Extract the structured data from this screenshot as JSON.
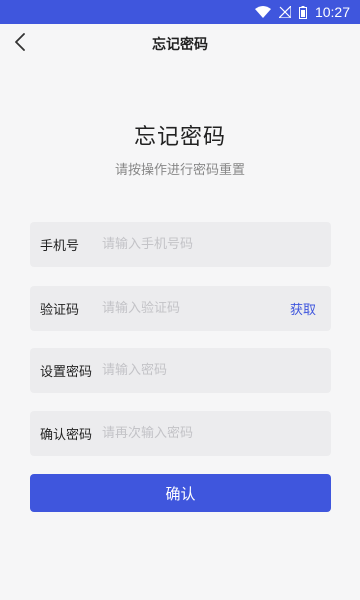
{
  "status_bar": {
    "time": "10:27",
    "icons": [
      "wifi-icon",
      "signal-icon",
      "battery-icon"
    ]
  },
  "nav": {
    "title": "忘记密码",
    "back_icon": "chevron-left-icon"
  },
  "hero": {
    "title": "忘记密码",
    "subtitle": "请按操作进行密码重置"
  },
  "form": {
    "phone": {
      "label": "手机号",
      "placeholder": "请输入手机号码",
      "value": ""
    },
    "code": {
      "label": "验证码",
      "placeholder": "请输入验证码",
      "value": "",
      "action_label": "获取"
    },
    "password": {
      "label": "设置密码",
      "placeholder": "请输入密码",
      "value": ""
    },
    "confirm_password": {
      "label": "确认密码",
      "placeholder": "请再次输入密码",
      "value": ""
    },
    "submit_label": "确认"
  },
  "colors": {
    "accent": "#3f56dd",
    "background": "#f6f6f7",
    "field_background": "#ececee",
    "placeholder": "#c3c3c7"
  }
}
